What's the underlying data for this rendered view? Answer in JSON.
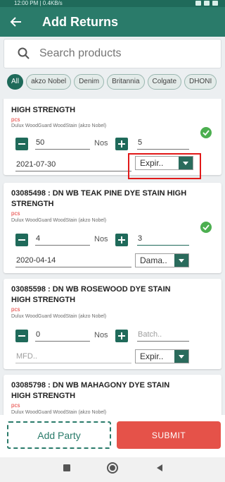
{
  "status_bar": {
    "text": "12:00 PM | 0.4KB/s"
  },
  "appbar": {
    "title": "Add Returns"
  },
  "search": {
    "placeholder": "Search products"
  },
  "filters": [
    "All",
    "akzo Nobel",
    "Denim",
    "Britannia",
    "Colgate",
    "DHONI"
  ],
  "products": [
    {
      "title": "HIGH STRENGTH",
      "unit": "pcs",
      "brand": "Dulux WoodGuard WoodStain (akzo Nobel)",
      "quantity": "50",
      "uom": "Nos",
      "batch": "5",
      "mfd": "2021-07-30",
      "reason": "Expir..",
      "checked": true
    },
    {
      "title": "03085498 : DN WB TEAK PINE DYE STAIN HIGH STRENGTH",
      "unit": "pcs",
      "brand": "Dulux WoodGuard WoodStain (akzo Nobel)",
      "quantity": "4",
      "uom": "Nos",
      "batch": "3",
      "mfd": "2020-04-14",
      "reason": "Dama..",
      "checked": true
    },
    {
      "title": "03085598 : DN WB ROSEWOOD DYE STAIN HIGH STRENGTH",
      "unit": "pcs",
      "brand": "Dulux WoodGuard WoodStain (akzo Nobel)",
      "quantity": "0",
      "uom": "Nos",
      "batch_placeholder": "Batch..",
      "mfd_placeholder": "MFD..",
      "reason": "Expir..",
      "checked": false
    },
    {
      "title": "03085798 : DN WB MAHAGONY DYE STAIN HIGH STRENGTH",
      "unit": "pcs",
      "brand": "Dulux WoodGuard WoodStain (akzo Nobel)"
    }
  ],
  "actions": {
    "add_party": "Add Party",
    "submit": "SUBMIT"
  },
  "colors": {
    "primary": "#2a7b6a",
    "dark": "#1f6a5a",
    "danger": "#e55249",
    "success": "#4caf50",
    "highlight": "#e11919"
  }
}
